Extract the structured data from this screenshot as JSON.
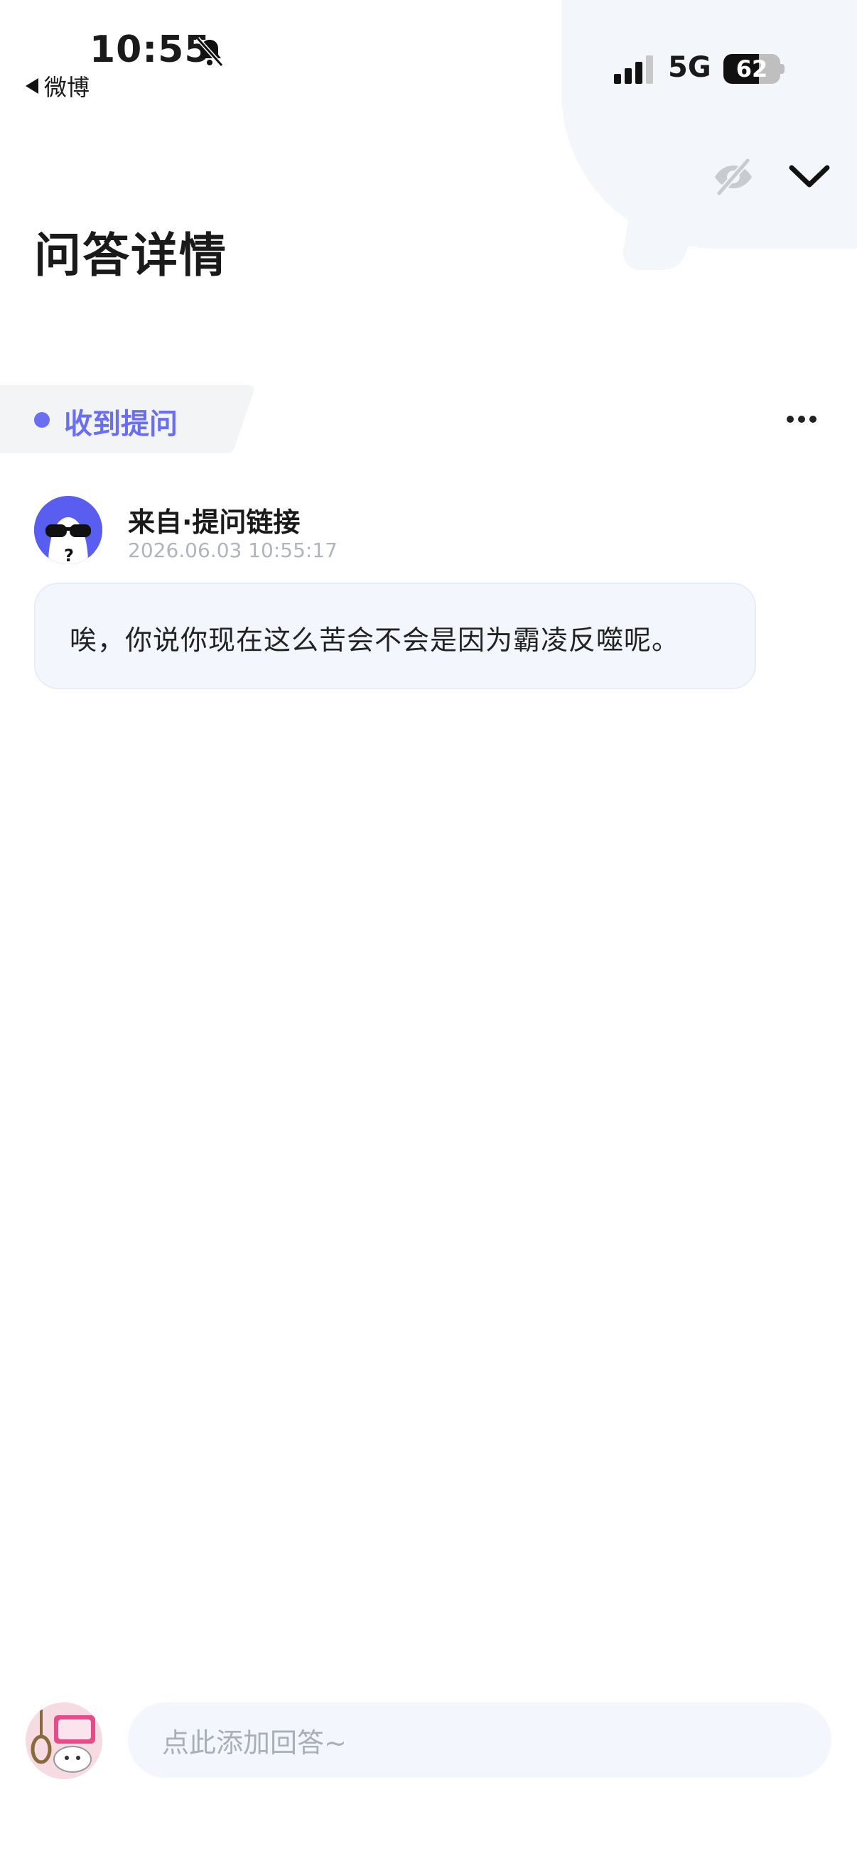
{
  "status_bar": {
    "time": "10:55",
    "back_app_label": "微博",
    "network": "5G",
    "battery_percent": "62",
    "battery_level": 0.62
  },
  "header": {
    "title": "问答详情",
    "icons": [
      "eye-off-icon",
      "chevron-down-icon"
    ]
  },
  "question": {
    "tag_label": "收到提问",
    "from_label": "来自·提问链接",
    "timestamp": "2026.06.03 10:55:17",
    "text": "唉，你说你现在这么苦会不会是因为霸凌反噬呢。"
  },
  "answer_bar": {
    "placeholder": "点此添加回答~"
  },
  "colors": {
    "accent": "#6a6ff2",
    "card_bg": "#f3f7fd",
    "muted": "#b0b5bd"
  }
}
